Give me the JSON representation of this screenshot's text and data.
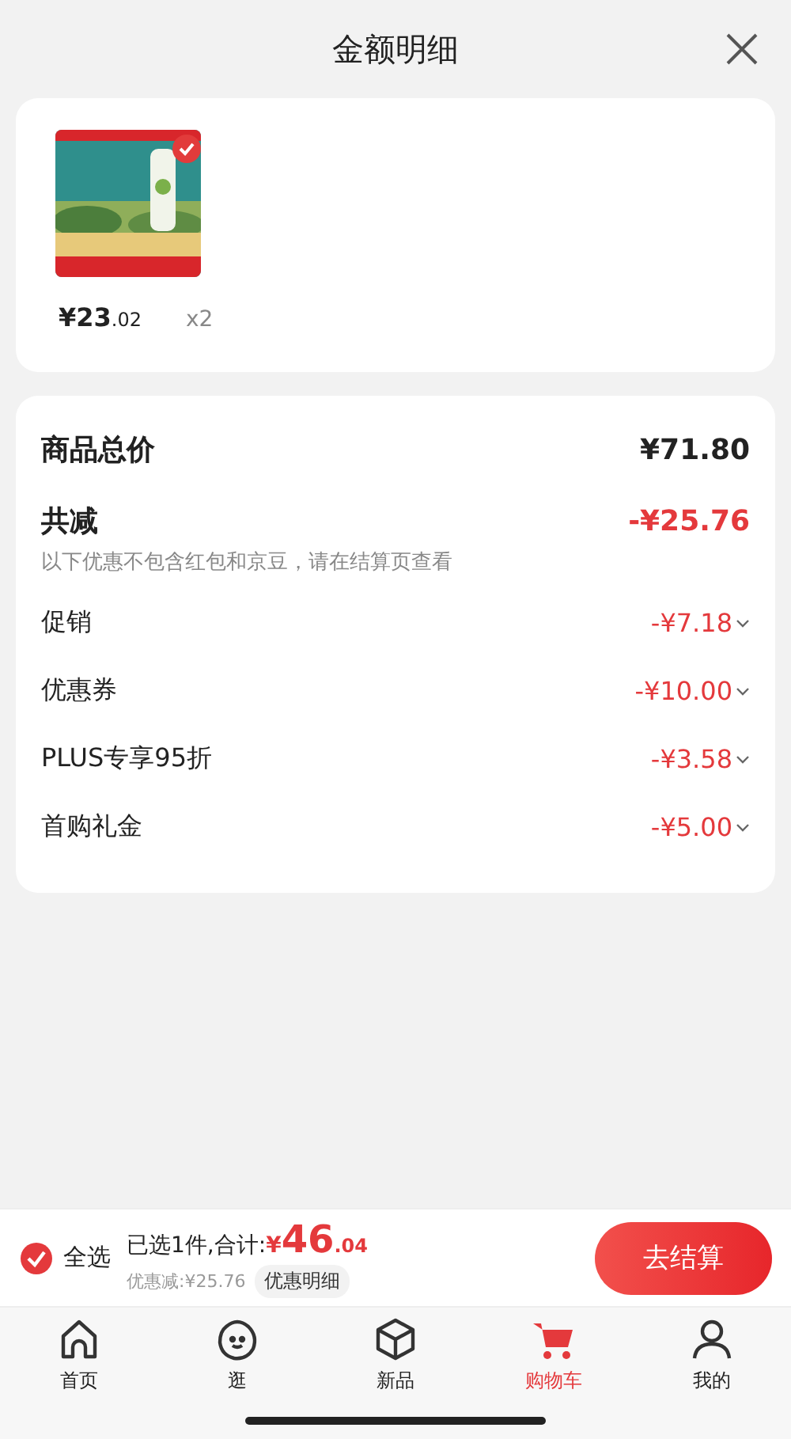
{
  "header": {
    "title": "金额明细"
  },
  "product": {
    "price_main": "¥23",
    "price_decimal": ".02",
    "quantity": "x2"
  },
  "summary": {
    "total_label": "商品总价",
    "total_value": "¥71.80",
    "reduction_label": "共减",
    "reduction_value": "-¥25.76",
    "note": "以下优惠不包含红包和京豆，请在结算页查看",
    "discounts": [
      {
        "label": "促销",
        "value": "-¥7.18"
      },
      {
        "label": "优惠券",
        "value": "-¥10.00"
      },
      {
        "label": "PLUS专享95折",
        "value": "-¥3.58"
      },
      {
        "label": "首购礼金",
        "value": "-¥5.00"
      }
    ]
  },
  "checkout": {
    "select_all": {
      "label": "全选",
      "checked": true
    },
    "selected_label": "已选1件,合计:",
    "currency": "¥",
    "amount_main": "46",
    "amount_decimal": ".04",
    "saving": "优惠减:¥25.76",
    "detail_button": "优惠明细",
    "submit": "去结算"
  },
  "tabs": [
    {
      "label": "首页",
      "kind": "home",
      "selected": false
    },
    {
      "label": "逛",
      "kind": "face",
      "selected": false
    },
    {
      "label": "新品",
      "kind": "box",
      "selected": false
    },
    {
      "label": "购物车",
      "kind": "cart",
      "selected": true
    },
    {
      "label": "我的",
      "kind": "person",
      "selected": false
    }
  ]
}
